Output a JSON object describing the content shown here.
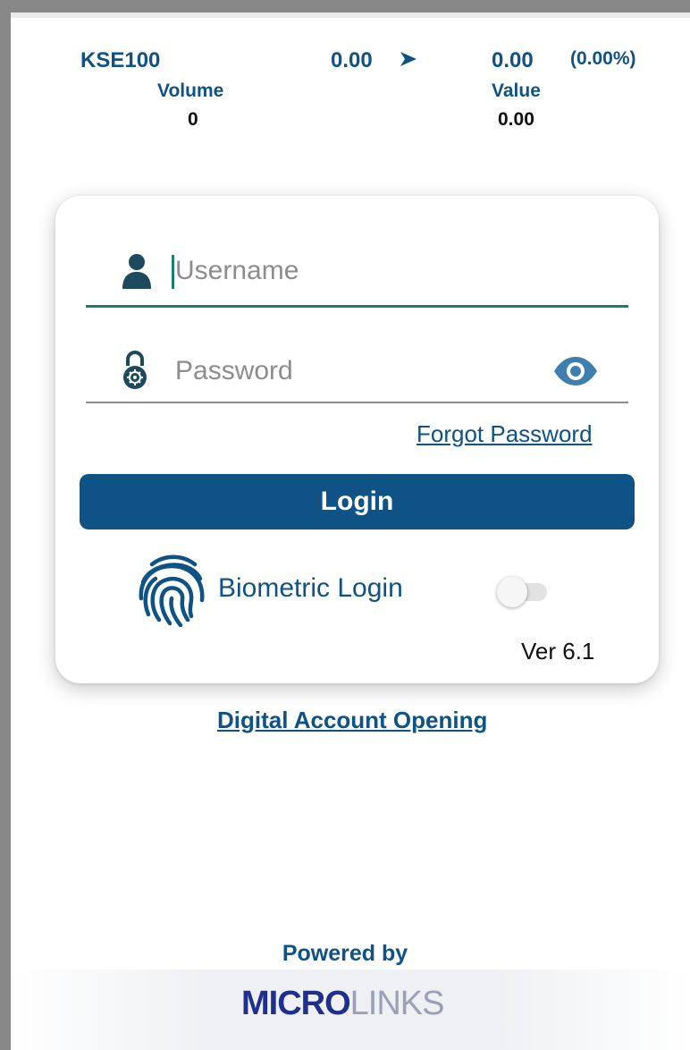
{
  "ticker": {
    "index_name": "KSE100",
    "value1": "0.00",
    "value2": "0.00",
    "percent": "(0.00%)",
    "volume_label": "Volume",
    "volume_value": "0",
    "value_label": "Value",
    "value_value": "0.00"
  },
  "login_form": {
    "username_placeholder": "Username",
    "username_value": "",
    "password_placeholder": "Password",
    "password_value": "",
    "forgot_password": "Forgot Password",
    "login_button": "Login",
    "biometric_label": "Biometric Login",
    "biometric_enabled": false,
    "version": "Ver 6.1"
  },
  "links": {
    "digital_account_opening": "Digital Account Opening"
  },
  "footer": {
    "powered_by": "Powered by",
    "logo_bold": "MICRO",
    "logo_light": "LINKS"
  },
  "icons": {
    "user": "user-icon",
    "lock": "lock-icon",
    "eye": "eye-icon",
    "fingerprint": "fingerprint-icon",
    "arrow": "arrow-right-icon"
  },
  "colors": {
    "brand": "#0e5286",
    "accent": "#1a7f6e",
    "logo": "#1f2f8c"
  }
}
